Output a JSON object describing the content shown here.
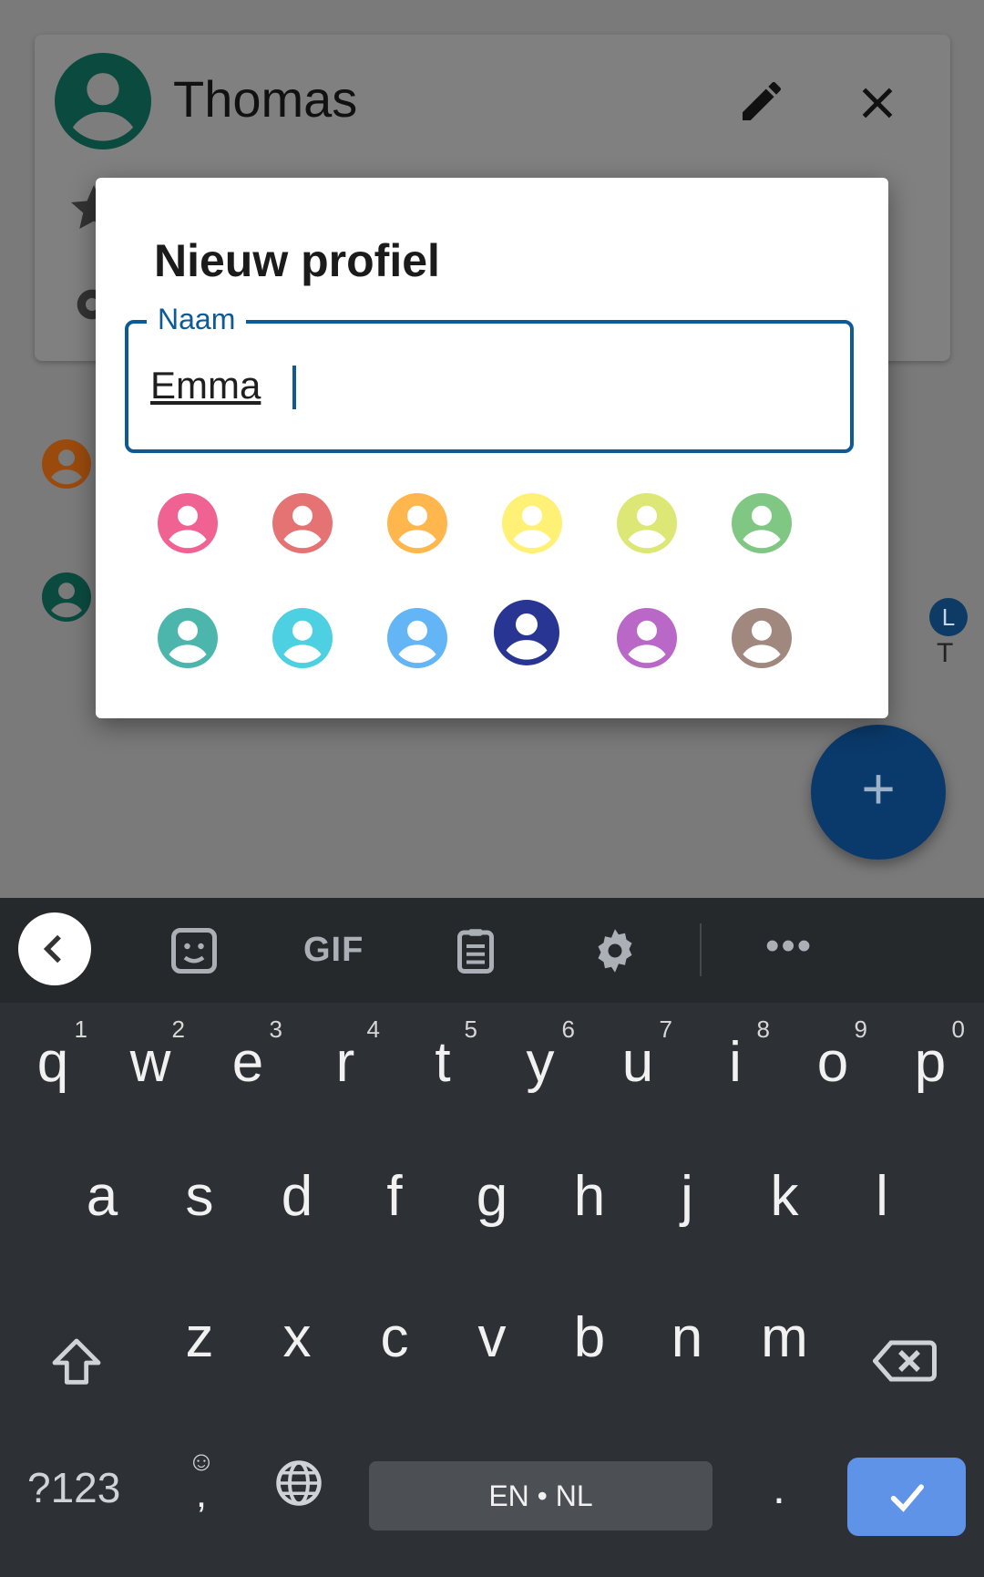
{
  "background": {
    "card_name": "Thomas",
    "badge_letter": "L",
    "side_letter": "T",
    "fab_icon": "+"
  },
  "dialog": {
    "title": "Nieuw profiel",
    "field_label": "Naam",
    "field_value": "Emma",
    "colors": [
      {
        "name": "pink",
        "hex": "#f06292",
        "selected": false
      },
      {
        "name": "red",
        "hex": "#e57373",
        "selected": false
      },
      {
        "name": "orange",
        "hex": "#ffb74d",
        "selected": false
      },
      {
        "name": "yellow",
        "hex": "#fff176",
        "selected": false
      },
      {
        "name": "lime",
        "hex": "#dce775",
        "selected": false
      },
      {
        "name": "green",
        "hex": "#81c784",
        "selected": false
      },
      {
        "name": "teal",
        "hex": "#4db6ac",
        "selected": false
      },
      {
        "name": "cyan",
        "hex": "#4dd0e1",
        "selected": false
      },
      {
        "name": "blue",
        "hex": "#64b5f6",
        "selected": false
      },
      {
        "name": "indigo",
        "hex": "#283593",
        "selected": true
      },
      {
        "name": "purple",
        "hex": "#ba68c8",
        "selected": false
      },
      {
        "name": "brown",
        "hex": "#a1887f",
        "selected": false
      }
    ]
  },
  "keyboard": {
    "toolbar": {
      "gif": "GIF",
      "more": "•••"
    },
    "row1": [
      {
        "ch": "q",
        "hint": "1"
      },
      {
        "ch": "w",
        "hint": "2"
      },
      {
        "ch": "e",
        "hint": "3"
      },
      {
        "ch": "r",
        "hint": "4"
      },
      {
        "ch": "t",
        "hint": "5"
      },
      {
        "ch": "y",
        "hint": "6"
      },
      {
        "ch": "u",
        "hint": "7"
      },
      {
        "ch": "i",
        "hint": "8"
      },
      {
        "ch": "o",
        "hint": "9"
      },
      {
        "ch": "p",
        "hint": "0"
      }
    ],
    "row2": [
      "a",
      "s",
      "d",
      "f",
      "g",
      "h",
      "j",
      "k",
      "l"
    ],
    "row3": [
      "z",
      "x",
      "c",
      "v",
      "b",
      "n",
      "m"
    ],
    "num_label": "?123",
    "emoji_small": "☺",
    "comma": ",",
    "space_label": "EN • NL",
    "period": "."
  },
  "colors": {
    "accent": "#0d5a96",
    "fab": "#0a3a6b",
    "enter": "#5f93e8",
    "keyboard_bg": "#2d3034"
  }
}
